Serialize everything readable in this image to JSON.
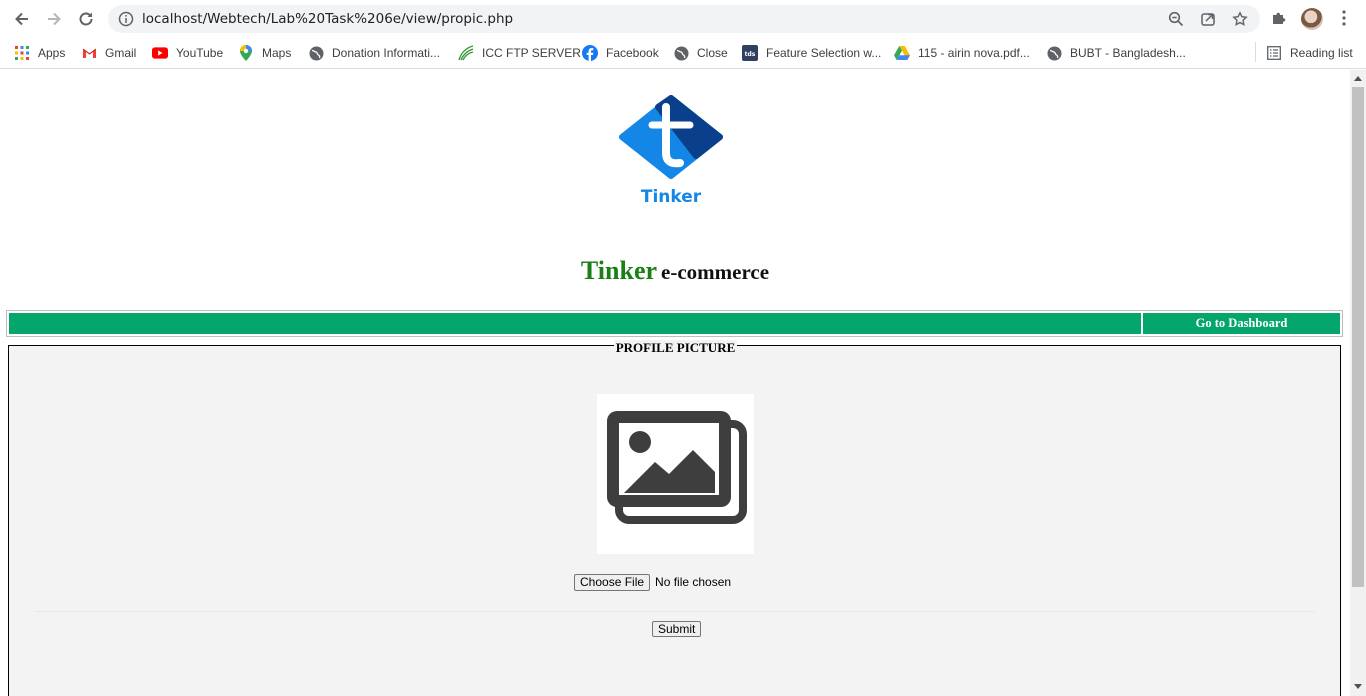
{
  "browser": {
    "url": "localhost/Webtech/Lab%20Task%206e/view/propic.php",
    "bookmarks": [
      {
        "label": "Apps",
        "icon": "apps-grid-icon"
      },
      {
        "label": "Gmail",
        "icon": "gmail-icon"
      },
      {
        "label": "YouTube",
        "icon": "youtube-icon"
      },
      {
        "label": "Maps",
        "icon": "maps-icon"
      },
      {
        "label": "Donation Informati...",
        "icon": "globe-icon"
      },
      {
        "label": "ICC FTP SERVER",
        "icon": "icc-ftp-icon"
      },
      {
        "label": "Facebook",
        "icon": "facebook-icon"
      },
      {
        "label": "Close",
        "icon": "globe-icon"
      },
      {
        "label": "Feature Selection w...",
        "icon": "tds-icon"
      },
      {
        "label": "115 - airin nova.pdf...",
        "icon": "google-drive-icon"
      },
      {
        "label": "BUBT - Bangladesh...",
        "icon": "globe-icon"
      }
    ],
    "reading_list": "Reading list",
    "tds_badge": "tds"
  },
  "page": {
    "logo_text": "Tinker",
    "brand_main": "Tinker",
    "brand_sub": "e-commerce",
    "nav_link": "Go to Dashboard",
    "legend": "PROFILE PICTURE",
    "choose_file": "Choose File",
    "file_status": "No file chosen",
    "submit": "Submit"
  },
  "colors": {
    "nav_green": "#05a66b",
    "brand_green": "#1a7f15",
    "logo_blue": "#1487e6",
    "logo_dark_blue": "#0a3f8c"
  }
}
